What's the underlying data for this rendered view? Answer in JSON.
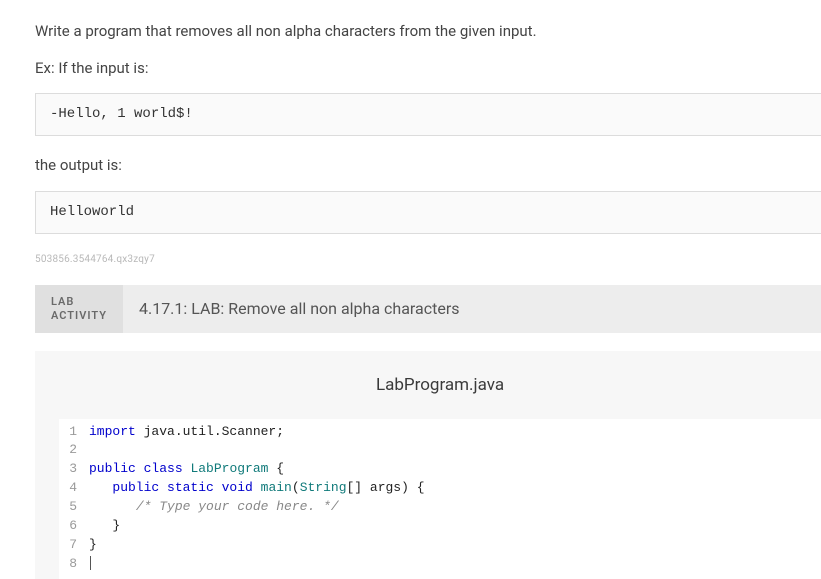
{
  "prompt": {
    "line1": "Write a program that removes all non alpha characters from the given input.",
    "line2": "Ex: If the input is:",
    "sampleInput": "-Hello, 1 world$!",
    "line3": "the output is:",
    "sampleOutput": "Helloworld"
  },
  "idString": "503856.3544764.qx3zqy7",
  "labBanner": {
    "badgeLine1": "LAB",
    "badgeLine2": "ACTIVITY",
    "title": "4.17.1: LAB: Remove all non alpha characters"
  },
  "editor": {
    "filename": "LabProgram.java",
    "lines": [
      {
        "n": "1",
        "tokens": [
          {
            "t": "kw",
            "v": "import"
          },
          {
            "t": "",
            "v": " java.util.Scanner;"
          }
        ]
      },
      {
        "n": "2",
        "tokens": []
      },
      {
        "n": "3",
        "tokens": [
          {
            "t": "kw",
            "v": "public class"
          },
          {
            "t": "",
            "v": " "
          },
          {
            "t": "cls",
            "v": "LabProgram"
          },
          {
            "t": "",
            "v": " {"
          }
        ]
      },
      {
        "n": "4",
        "tokens": [
          {
            "t": "",
            "v": "   "
          },
          {
            "t": "kw",
            "v": "public static void"
          },
          {
            "t": "",
            "v": " "
          },
          {
            "t": "cls",
            "v": "main"
          },
          {
            "t": "",
            "v": "("
          },
          {
            "t": "cls",
            "v": "String"
          },
          {
            "t": "",
            "v": "[] args) {"
          }
        ]
      },
      {
        "n": "5",
        "tokens": [
          {
            "t": "",
            "v": "      "
          },
          {
            "t": "com",
            "v": "/* Type your code here. */"
          }
        ]
      },
      {
        "n": "6",
        "tokens": [
          {
            "t": "",
            "v": "   }"
          }
        ]
      },
      {
        "n": "7",
        "tokens": [
          {
            "t": "",
            "v": "}"
          }
        ]
      },
      {
        "n": "8",
        "tokens": [],
        "cursor": true
      }
    ]
  }
}
